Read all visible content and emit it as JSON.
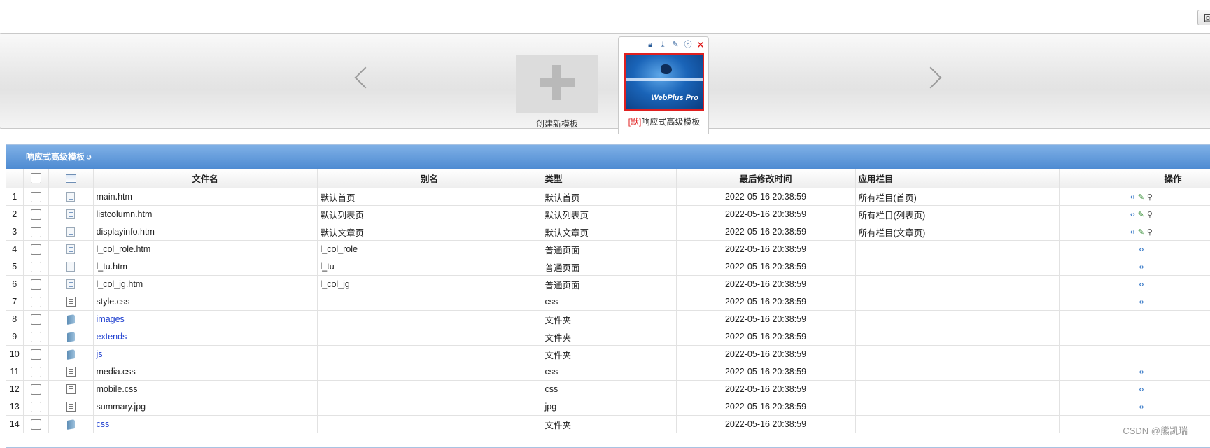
{
  "topbar": {
    "button_label": "回"
  },
  "carousel": {
    "new_template_label": "创建新模板",
    "active_template": {
      "default_tag": "[默]",
      "name": "响应式高级模板",
      "preview_text": "WebPlus Pro",
      "icons": [
        "lock-icon",
        "export-icon",
        "edit-icon",
        "preview-icon",
        "close-icon"
      ]
    }
  },
  "panel": {
    "title": "响应式高级模板",
    "refresh_glyph": "↺",
    "columns": [
      "文件名",
      "别名",
      "类型",
      "最后修改时间",
      "应用栏目",
      "操作"
    ],
    "rows": [
      {
        "num": "1",
        "icon": "html",
        "name": "main.htm",
        "alias": "默认首页",
        "type": "默认首页",
        "time": "2022-05-16 20:38:59",
        "column": "所有栏目(首页)",
        "ops": [
          "code",
          "edit",
          "view"
        ],
        "dir": false
      },
      {
        "num": "2",
        "icon": "html",
        "name": "listcolumn.htm",
        "alias": "默认列表页",
        "type": "默认列表页",
        "time": "2022-05-16 20:38:59",
        "column": "所有栏目(列表页)",
        "ops": [
          "code",
          "edit",
          "view"
        ],
        "dir": false
      },
      {
        "num": "3",
        "icon": "html",
        "name": "displayinfo.htm",
        "alias": "默认文章页",
        "type": "默认文章页",
        "time": "2022-05-16 20:38:59",
        "column": "所有栏目(文章页)",
        "ops": [
          "code",
          "edit",
          "view"
        ],
        "dir": false
      },
      {
        "num": "4",
        "icon": "html",
        "name": "l_col_role.htm",
        "alias": "l_col_role",
        "type": "普通页面",
        "time": "2022-05-16 20:38:59",
        "column": "",
        "ops": [
          "code"
        ],
        "dir": false
      },
      {
        "num": "5",
        "icon": "html",
        "name": "l_tu.htm",
        "alias": "l_tu",
        "type": "普通页面",
        "time": "2022-05-16 20:38:59",
        "column": "",
        "ops": [
          "code"
        ],
        "dir": false
      },
      {
        "num": "6",
        "icon": "html",
        "name": "l_col_jg.htm",
        "alias": "l_col_jg",
        "type": "普通页面",
        "time": "2022-05-16 20:38:59",
        "column": "",
        "ops": [
          "code"
        ],
        "dir": false
      },
      {
        "num": "7",
        "icon": "text",
        "name": "style.css",
        "alias": "",
        "type": "css",
        "time": "2022-05-16 20:38:59",
        "column": "",
        "ops": [
          "code"
        ],
        "dir": false
      },
      {
        "num": "8",
        "icon": "folder",
        "name": "images",
        "alias": "",
        "type": "文件夹",
        "time": "2022-05-16 20:38:59",
        "column": "",
        "ops": [],
        "dir": true
      },
      {
        "num": "9",
        "icon": "folder",
        "name": "extends",
        "alias": "",
        "type": "文件夹",
        "time": "2022-05-16 20:38:59",
        "column": "",
        "ops": [],
        "dir": true
      },
      {
        "num": "10",
        "icon": "folder",
        "name": "js",
        "alias": "",
        "type": "文件夹",
        "time": "2022-05-16 20:38:59",
        "column": "",
        "ops": [],
        "dir": true
      },
      {
        "num": "11",
        "icon": "text",
        "name": "media.css",
        "alias": "",
        "type": "css",
        "time": "2022-05-16 20:38:59",
        "column": "",
        "ops": [
          "code"
        ],
        "dir": false
      },
      {
        "num": "12",
        "icon": "text",
        "name": "mobile.css",
        "alias": "",
        "type": "css",
        "time": "2022-05-16 20:38:59",
        "column": "",
        "ops": [
          "code"
        ],
        "dir": false
      },
      {
        "num": "13",
        "icon": "text",
        "name": "summary.jpg",
        "alias": "",
        "type": "jpg",
        "time": "2022-05-16 20:38:59",
        "column": "",
        "ops": [
          "code"
        ],
        "dir": false
      },
      {
        "num": "14",
        "icon": "folder",
        "name": "css",
        "alias": "",
        "type": "文件夹",
        "time": "2022-05-16 20:38:59",
        "column": "",
        "ops": [],
        "dir": true
      }
    ]
  },
  "watermark": "CSDN @熊凯瑞"
}
